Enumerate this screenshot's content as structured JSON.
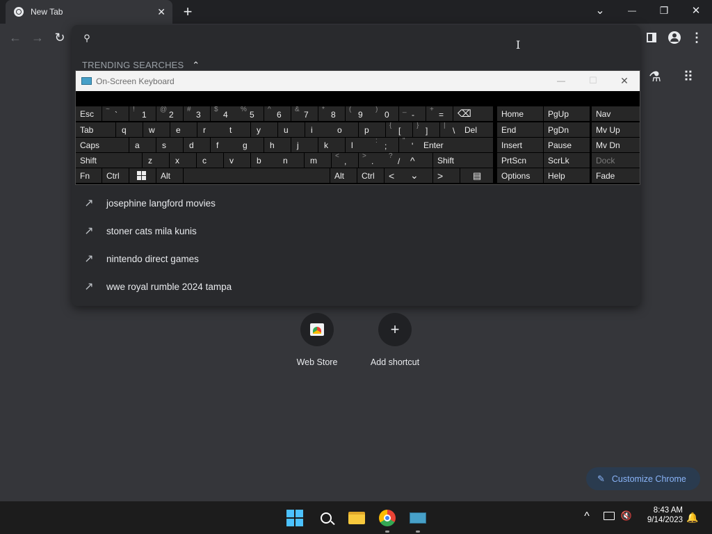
{
  "browser": {
    "tab_title": "New Tab",
    "new_tab": "+",
    "window": {
      "min": "—",
      "max": "❐",
      "close": "✕",
      "search_tabs": "⌄"
    }
  },
  "omnibox": {
    "value": "",
    "trending_label": "TRENDING SEARCHES",
    "suggestions": [
      "josephine langford movies",
      "stoner cats mila kunis",
      "nintendo direct games",
      "wwe royal rumble 2024 tampa"
    ]
  },
  "osk": {
    "title": "On-Screen Keyboard",
    "keys": {
      "esc": "Esc",
      "tilde_s": "~",
      "tilde_m": "`",
      "n1_s": "!",
      "n1": "1",
      "n2_s": "@",
      "n2": "2",
      "n3_s": "#",
      "n3": "3",
      "n4_s": "$",
      "n4": "4",
      "n5_s": "%",
      "n5": "5",
      "n6_s": "^",
      "n6": "6",
      "n7_s": "&",
      "n7": "7",
      "n8_s": "*",
      "n8": "8",
      "n9_s": "(",
      "n9": "9",
      "n0_s": ")",
      "n0": "0",
      "minus_s": "_",
      "minus": "-",
      "eq_s": "+",
      "eq": "=",
      "bksp": "⌫",
      "tab": "Tab",
      "q": "q",
      "w": "w",
      "e": "e",
      "r": "r",
      "t": "t",
      "y": "y",
      "u": "u",
      "i": "i",
      "o": "o",
      "p": "p",
      "lb_s": "{",
      "lb": "[",
      "rb_s": "}",
      "rb": "]",
      "bs_s": "|",
      "bs": "\\",
      "del": "Del",
      "caps": "Caps",
      "a": "a",
      "s": "s",
      "d": "d",
      "f": "f",
      "g": "g",
      "h": "h",
      "j": "j",
      "k": "k",
      "l": "l",
      "sc_s": ":",
      "sc": ";",
      "qt_s": "\"",
      "qt": "'",
      "enter": "Enter",
      "shift": "Shift",
      "z": "z",
      "x": "x",
      "c": "c",
      "v": "v",
      "b": "b",
      "n": "n",
      "m": "m",
      "cm_s": "<",
      "cm": ",",
      "pd_s": ">",
      "pd": ".",
      "sl_s": "?",
      "sl": "/",
      "up": "^",
      "rshift": "Shift",
      "fn": "Fn",
      "ctrl": "Ctrl",
      "alt": "Alt",
      "ralt": "Alt",
      "rctrl": "Ctrl",
      "left": "<",
      "down": "⌄",
      "right": ">",
      "menu": "▤",
      "home": "Home",
      "pgup": "PgUp",
      "nav": "Nav",
      "end": "End",
      "pgdn": "PgDn",
      "mvup": "Mv Up",
      "insert": "Insert",
      "pause": "Pause",
      "mvdn": "Mv Dn",
      "prtscn": "PrtScn",
      "scrlk": "ScrLk",
      "dock": "Dock",
      "options": "Options",
      "help": "Help",
      "fade": "Fade"
    }
  },
  "shortcuts": [
    {
      "label": "Web Store"
    },
    {
      "label": "Add shortcut",
      "glyph": "+"
    }
  ],
  "customize": "Customize Chrome",
  "taskbar": {
    "time": "8:43 AM",
    "date": "9/14/2023",
    "chevron": "^"
  }
}
